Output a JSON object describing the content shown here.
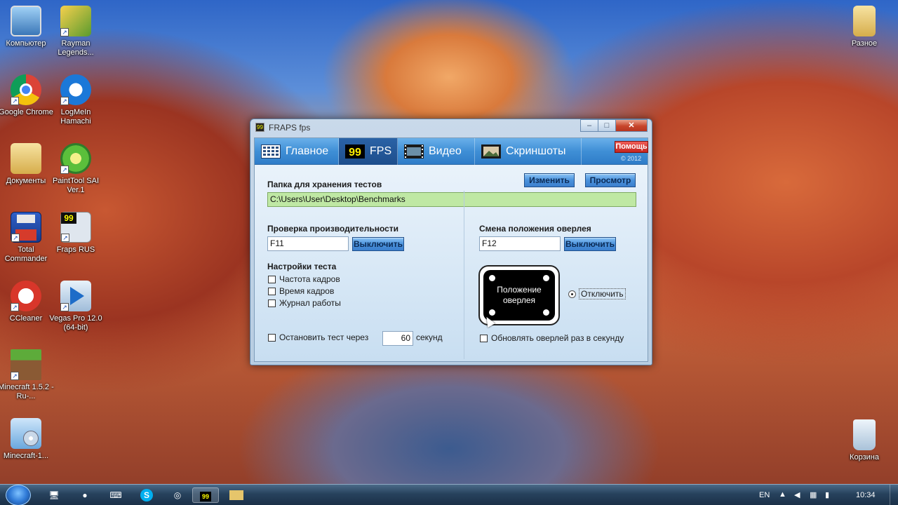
{
  "desktop": {
    "icons": [
      {
        "label": "Компьютер"
      },
      {
        "label": "Rayman Legends..."
      },
      {
        "label": "Google Chrome"
      },
      {
        "label": "LogMeIn Hamachi"
      },
      {
        "label": "Документы"
      },
      {
        "label": "PaintTool SAI Ver.1"
      },
      {
        "label": "Total Commander"
      },
      {
        "label": "Fraps RUS"
      },
      {
        "label": "CCleaner"
      },
      {
        "label": "Vegas Pro 12.0 (64-bit)"
      },
      {
        "label": "Minecraft 1.5.2 - Ru-..."
      },
      {
        "label": "Minecraft-1..."
      },
      {
        "label": "Разное"
      },
      {
        "label": "Корзина"
      }
    ]
  },
  "window": {
    "title": "FRAPS fps",
    "tabs": [
      {
        "label": "Главное",
        "icon": "grid-icon"
      },
      {
        "label": "FPS",
        "icon": "99-counter-icon"
      },
      {
        "label": "Видео",
        "icon": "film-icon"
      },
      {
        "label": "Скриншоты",
        "icon": "picture-icon"
      }
    ],
    "help_label": "Помощь",
    "copyright": "© 2012",
    "folder_label": "Папка для хранения тестов",
    "change_btn": "Изменить",
    "browse_btn": "Просмотр",
    "folder_path": "C:\\Users\\User\\Desktop\\Benchmarks",
    "perf_label": "Проверка производительности",
    "perf_hotkey": "F11",
    "perf_btn": "Выключить",
    "overlay_label": "Смена положения оверлея",
    "overlay_hotkey": "F12",
    "overlay_btn": "Выключить",
    "test_settings_label": "Настройки теста",
    "checkboxes": [
      {
        "label": "Частота кадров"
      },
      {
        "label": "Время кадров"
      },
      {
        "label": "Журнал работы"
      }
    ],
    "stop_test_label": "Остановить тест через",
    "stop_test_value": "60",
    "seconds_label": "секунд",
    "overlay_position_text": "Положение оверлея",
    "disable_radio_label": "Отключить",
    "update_overlay_label": "Обновлять оверлей раз в секунду"
  },
  "taskbar": {
    "lang": "EN",
    "time": "10:34"
  }
}
